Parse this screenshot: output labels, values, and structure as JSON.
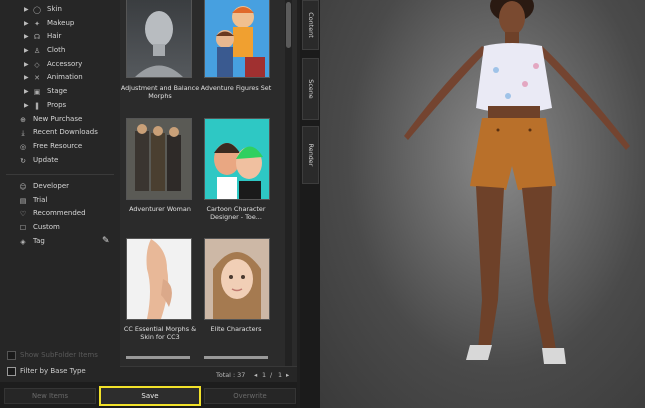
{
  "tree": {
    "items": [
      {
        "label": "Skin",
        "icon": "skin-icon"
      },
      {
        "label": "Makeup",
        "icon": "makeup-icon"
      },
      {
        "label": "Hair",
        "icon": "hair-icon"
      },
      {
        "label": "Cloth",
        "icon": "cloth-icon"
      },
      {
        "label": "Accessory",
        "icon": "accessory-icon"
      },
      {
        "label": "Animation",
        "icon": "animation-icon"
      },
      {
        "label": "Stage",
        "icon": "stage-icon"
      },
      {
        "label": "Props",
        "icon": "props-icon"
      }
    ]
  },
  "quick": {
    "items": [
      {
        "label": "New Purchase",
        "icon": "new-purchase-icon"
      },
      {
        "label": "Recent Downloads",
        "icon": "download-icon"
      },
      {
        "label": "Free Resource",
        "icon": "free-resource-icon"
      },
      {
        "label": "Update",
        "icon": "update-icon"
      }
    ]
  },
  "filters": {
    "items": [
      {
        "label": "Developer",
        "icon": "developer-icon"
      },
      {
        "label": "Trial",
        "icon": "trial-icon"
      },
      {
        "label": "Recommended",
        "icon": "recommended-icon"
      },
      {
        "label": "Custom",
        "icon": "custom-icon"
      },
      {
        "label": "Tag",
        "icon": "tag-icon"
      }
    ]
  },
  "options": {
    "show_subfolder": "Show SubFolder Items",
    "filter_base_type": "Filter by Base Type"
  },
  "library": {
    "items": [
      {
        "caption": "Adjustment and Balance Morphs"
      },
      {
        "caption": "Adventure Figures Set"
      },
      {
        "caption": "Adventurer Woman"
      },
      {
        "caption": "Cartoon Character Designer - Toe..."
      },
      {
        "caption": "CC Essential Morphs & Skin for CC3"
      },
      {
        "caption": "Elite Characters"
      }
    ],
    "total": "Total : 37",
    "page_current": "1",
    "page_sep": "/",
    "page_total": "1"
  },
  "toolbar": {
    "left_label": "New Items",
    "save_label": "Save",
    "right_label": "Overwrite"
  },
  "side_tabs": {
    "content": "Content",
    "scene": "Scene",
    "render": "Render"
  },
  "colors": {
    "highlight": "#f1e12a",
    "panel": "#262626",
    "background": "#1f1f1f"
  }
}
